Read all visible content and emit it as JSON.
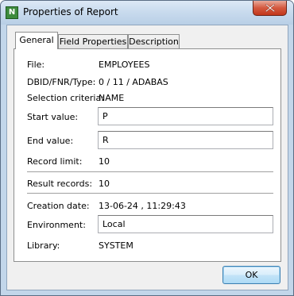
{
  "window": {
    "title": "Properties of Report",
    "app_icon_letter": "N",
    "app_icon_name": "natural-app-icon",
    "close_icon_name": "close-icon"
  },
  "tabs": [
    {
      "label": "General",
      "active": true
    },
    {
      "label": "Field Properties",
      "active": false
    },
    {
      "label": "Description",
      "active": false
    }
  ],
  "general": {
    "file": {
      "label": "File:",
      "value": "EMPLOYEES"
    },
    "dbid": {
      "label": "DBID/FNR/Type:",
      "value": "0 / 11 / ADABAS"
    },
    "selection": {
      "label": "Selection criteria:",
      "value": "NAME"
    },
    "start": {
      "label": "Start value:",
      "value": "P"
    },
    "end": {
      "label": "End value:",
      "value": "R"
    },
    "record_limit": {
      "label": "Record limit:",
      "value": "10"
    },
    "result_records": {
      "label": "Result records:",
      "value": "10"
    },
    "creation_date": {
      "label": "Creation date:",
      "value": "13-06-24 , 11:29:43"
    },
    "environment": {
      "label": "Environment:",
      "value": "Local"
    },
    "library": {
      "label": "Library:",
      "value": "SYSTEM"
    }
  },
  "buttons": {
    "ok": "OK"
  }
}
